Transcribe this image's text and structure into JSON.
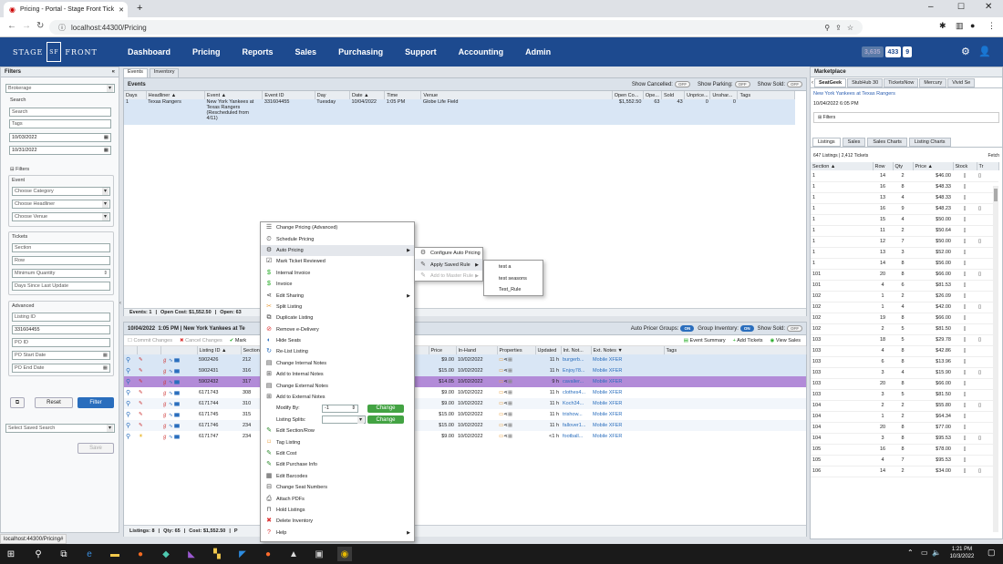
{
  "browser": {
    "tab_title": "Pricing - Portal - Stage Front Tick",
    "url": "localhost:44300/Pricing",
    "status_url": "localhost:44300/Pricing#"
  },
  "nav": {
    "logo_left": "STAGE",
    "logo_mid": "SF",
    "logo_right": "FRONT",
    "items": [
      "Dashboard",
      "Pricing",
      "Reports",
      "Sales",
      "Purchasing",
      "Support",
      "Accounting",
      "Admin"
    ],
    "badge1": "3,635",
    "badge2": "433",
    "badge3": "9"
  },
  "filters": {
    "title": "Filters",
    "collapse": "«",
    "dropdown": "Brokerage",
    "search_label": "Search",
    "search_ph": "Search",
    "tags_ph": "Tags",
    "date_from": "10/03/2022",
    "date_to": "10/31/2022",
    "section_label": "Filters",
    "event_label": "Event",
    "event_opts": [
      "Choose Category",
      "Choose Headliner",
      "Choose Venue"
    ],
    "tickets_label": "Tickets",
    "ticket_fields": [
      "Section",
      "Row",
      "Minimum Quantity",
      "Days Since Last Update"
    ],
    "advanced_label": "Advanced",
    "adv_fields": [
      "Listing ID",
      "331604455",
      "PO ID",
      "PO Start Date",
      "PO End Date"
    ],
    "reset": "Reset",
    "filter": "Filter",
    "saved_search": "Select Saved Search",
    "save": "Save"
  },
  "events": {
    "tabs": [
      "Events",
      "Inventory"
    ],
    "title": "Events",
    "show_cancelled": "Show Cancelled:",
    "show_parking": "Show Parking:",
    "show_sold": "Show Sold:",
    "off": "OFF",
    "on": "ON",
    "cols": [
      "Days",
      "Headliner ▲",
      "Event ▲",
      "Event ID",
      "Day",
      "Date ▲",
      "Time",
      "Venue",
      "Open Co...",
      "Ope...",
      "Sold",
      "Unprice...",
      "Unshar...",
      "Tags"
    ],
    "row": [
      "1",
      "Texas Rangers",
      "New York Yankees at Texas Rangers (Rescheduled from 4/11)",
      "331604455",
      "Tuesday",
      "10/04/2022",
      "1:05 PM",
      "Globe Life Field",
      "$1,552.50",
      "63",
      "43",
      "0",
      "0",
      ""
    ],
    "footer_events": "Events: 1",
    "footer_open_cost": "Open Cost: $1,552.50",
    "footer_open": "Open: 63"
  },
  "inventory": {
    "date": "10/04/2022",
    "time": "1:05 PM",
    "event": "New York Yankees at Te",
    "auto_pricer_groups": "Auto Pricer Groups:",
    "group_inventory": "Group Inventory:",
    "show_sold": "Show Sold:",
    "commit": "Commit Changes",
    "cancel": "Cancel Changes",
    "mark": "Mark",
    "event_summary": "Event Summary",
    "add_tickets": "Add Tickets",
    "view_sales": "View Sales",
    "cols_left": [
      "",
      "",
      "",
      "Listing ID ▲",
      "Section"
    ],
    "cols_right": [
      "Price",
      "In-Hand",
      "Properties",
      "Updated",
      "Int. Not...",
      "Ext. Notes ▼",
      "Tags"
    ],
    "rows": [
      {
        "id": "5902426",
        "sec": "212",
        "price": "$9.00",
        "inhand": "10/02/2022",
        "upd": "11 h",
        "int": "burgerb...",
        "ext": "Mobile XFER"
      },
      {
        "id": "5902431",
        "sec": "316",
        "price": "$15.00",
        "inhand": "10/02/2022",
        "upd": "11 h",
        "int": "Enjoy78...",
        "ext": "Mobile XFER"
      },
      {
        "id": "5902432",
        "sec": "317",
        "price": "$14.05",
        "inhand": "10/02/2022",
        "upd": "9 h",
        "int": "cavalier...",
        "ext": "Mobile XFER"
      },
      {
        "id": "6171743",
        "sec": "308",
        "price": "$9.00",
        "inhand": "10/02/2022",
        "upd": "11 h",
        "int": "clothes4...",
        "ext": "Mobile XFER"
      },
      {
        "id": "6171744",
        "sec": "310",
        "price": "$9.00",
        "inhand": "10/02/2022",
        "upd": "11 h",
        "int": "Koch34...",
        "ext": "Mobile XFER"
      },
      {
        "id": "6171745",
        "sec": "315",
        "price": "$15.00",
        "inhand": "10/02/2022",
        "upd": "11 h",
        "int": "trishow...",
        "ext": "Mobile XFER"
      },
      {
        "id": "6171746",
        "sec": "234",
        "price": "$15.00",
        "inhand": "10/02/2022",
        "upd": "11 h",
        "int": "fallover1...",
        "ext": "Mobile XFER"
      },
      {
        "id": "6171747",
        "sec": "234",
        "price": "$9.00",
        "inhand": "10/02/2022",
        "upd": "<1 h",
        "int": "football...",
        "ext": "Mobile XFER"
      }
    ],
    "footer_listings": "Listings: 8",
    "footer_qty": "Qty: 65",
    "footer_cost": "Cost: $1,552.50",
    "footer_p": "P"
  },
  "context_menu": {
    "items": [
      {
        "label": "Change Pricing (Advanced)",
        "icon": "pricing-icon"
      },
      {
        "label": "Schedule Pricing",
        "icon": "schedule-icon"
      },
      {
        "label": "Auto Pricing",
        "icon": "auto-pricing-icon",
        "sub": true
      },
      {
        "label": "Mark Ticket Reviewed",
        "icon": "checkbox-icon"
      },
      {
        "label": "Internal Invoice",
        "icon": "dollar-icon"
      },
      {
        "label": "Invoice",
        "icon": "dollar-icon"
      },
      {
        "label": "Edit Sharing",
        "icon": "share-icon",
        "sub": true
      },
      {
        "label": "Split Listing",
        "icon": "split-icon"
      },
      {
        "label": "Duplicate Listing",
        "icon": "duplicate-icon"
      },
      {
        "label": "Remove e-Delivery",
        "icon": "remove-delivery-icon"
      },
      {
        "label": "Hide Seats",
        "icon": "hide-icon"
      },
      {
        "label": "Re-List Listing",
        "icon": "relist-icon"
      },
      {
        "label": "Change Internal Notes",
        "icon": "notes-icon"
      },
      {
        "label": "Add to Internal Notes",
        "icon": "add-notes-icon"
      },
      {
        "label": "Change External Notes",
        "icon": "notes-icon"
      },
      {
        "label": "Add to External Notes",
        "icon": "add-notes-icon"
      }
    ],
    "modify_by_label": "Modify By:",
    "modify_by_value": "-1",
    "listing_splits_label": "Listing Splits:",
    "change": "Change",
    "items2": [
      {
        "label": "Edit Section/Row",
        "icon": "edit-icon"
      },
      {
        "label": "Tag Listing",
        "icon": "tag-icon"
      },
      {
        "label": "Edit Cost",
        "icon": "edit-icon"
      },
      {
        "label": "Edit Purchase Info",
        "icon": "edit-icon"
      },
      {
        "label": "Edit Barcodes",
        "icon": "barcode-icon"
      },
      {
        "label": "Change Seat Numbers",
        "icon": "seat-icon"
      },
      {
        "label": "Attach PDFs",
        "icon": "pdf-icon"
      },
      {
        "label": "Hold Listings",
        "icon": "lock-icon"
      },
      {
        "label": "Delete Inventory",
        "icon": "delete-icon"
      },
      {
        "label": "Help",
        "icon": "help-icon",
        "sub": true
      }
    ],
    "auto_sub": [
      "Configure Auto Pricing",
      "Apply Saved Rule",
      "Add to Master Rule"
    ],
    "rules": [
      "test a",
      "test seasons",
      "Test_Rule"
    ]
  },
  "marketplace": {
    "title": "Marketplace",
    "tabs": [
      "SeatGeek",
      "StubHub 30",
      "TicketsNow",
      "Mercury",
      "Vivid Se"
    ],
    "event": "New York Yankees at Texas Rangers",
    "datetime": "10/04/2022 6:05 PM",
    "filters": "Filters",
    "subtabs": [
      "Listings",
      "Sales",
      "Sales Charts",
      "Listing Charts"
    ],
    "summary": "647 Listings | 2,412 Tickets",
    "fetch": "Fetch",
    "cols": [
      "Section ▲",
      "Row",
      "Qty",
      "Price ▲",
      "Stock",
      "Tr"
    ],
    "rows": [
      [
        "1",
        "14",
        "2",
        "$46.00"
      ],
      [
        "1",
        "16",
        "8",
        "$48.33"
      ],
      [
        "1",
        "13",
        "4",
        "$48.33"
      ],
      [
        "1",
        "16",
        "9",
        "$48.23"
      ],
      [
        "1",
        "15",
        "4",
        "$50.00"
      ],
      [
        "1",
        "11",
        "2",
        "$50.64"
      ],
      [
        "1",
        "12",
        "7",
        "$50.00"
      ],
      [
        "1",
        "13",
        "3",
        "$52.00"
      ],
      [
        "1",
        "14",
        "8",
        "$56.00"
      ],
      [
        "101",
        "20",
        "8",
        "$66.00"
      ],
      [
        "101",
        "4",
        "6",
        "$81.53"
      ],
      [
        "102",
        "1",
        "2",
        "$26.09"
      ],
      [
        "102",
        "1",
        "4",
        "$42.00"
      ],
      [
        "102",
        "19",
        "8",
        "$66.00"
      ],
      [
        "102",
        "2",
        "5",
        "$81.50"
      ],
      [
        "103",
        "18",
        "5",
        "$29.78"
      ],
      [
        "103",
        "4",
        "8",
        "$42.86"
      ],
      [
        "103",
        "6",
        "8",
        "$13.96"
      ],
      [
        "103",
        "3",
        "4",
        "$15.90"
      ],
      [
        "103",
        "20",
        "8",
        "$66.00"
      ],
      [
        "103",
        "3",
        "5",
        "$81.50"
      ],
      [
        "104",
        "2",
        "2",
        "$55.80"
      ],
      [
        "104",
        "1",
        "2",
        "$64.34"
      ],
      [
        "104",
        "20",
        "8",
        "$77.00"
      ],
      [
        "104",
        "3",
        "8",
        "$95.53"
      ],
      [
        "105",
        "16",
        "8",
        "$78.00"
      ],
      [
        "105",
        "4",
        "7",
        "$95.53"
      ],
      [
        "106",
        "14",
        "2",
        "$34.00"
      ]
    ]
  },
  "taskbar": {
    "time": "1:21 PM",
    "date": "10/3/2022"
  }
}
